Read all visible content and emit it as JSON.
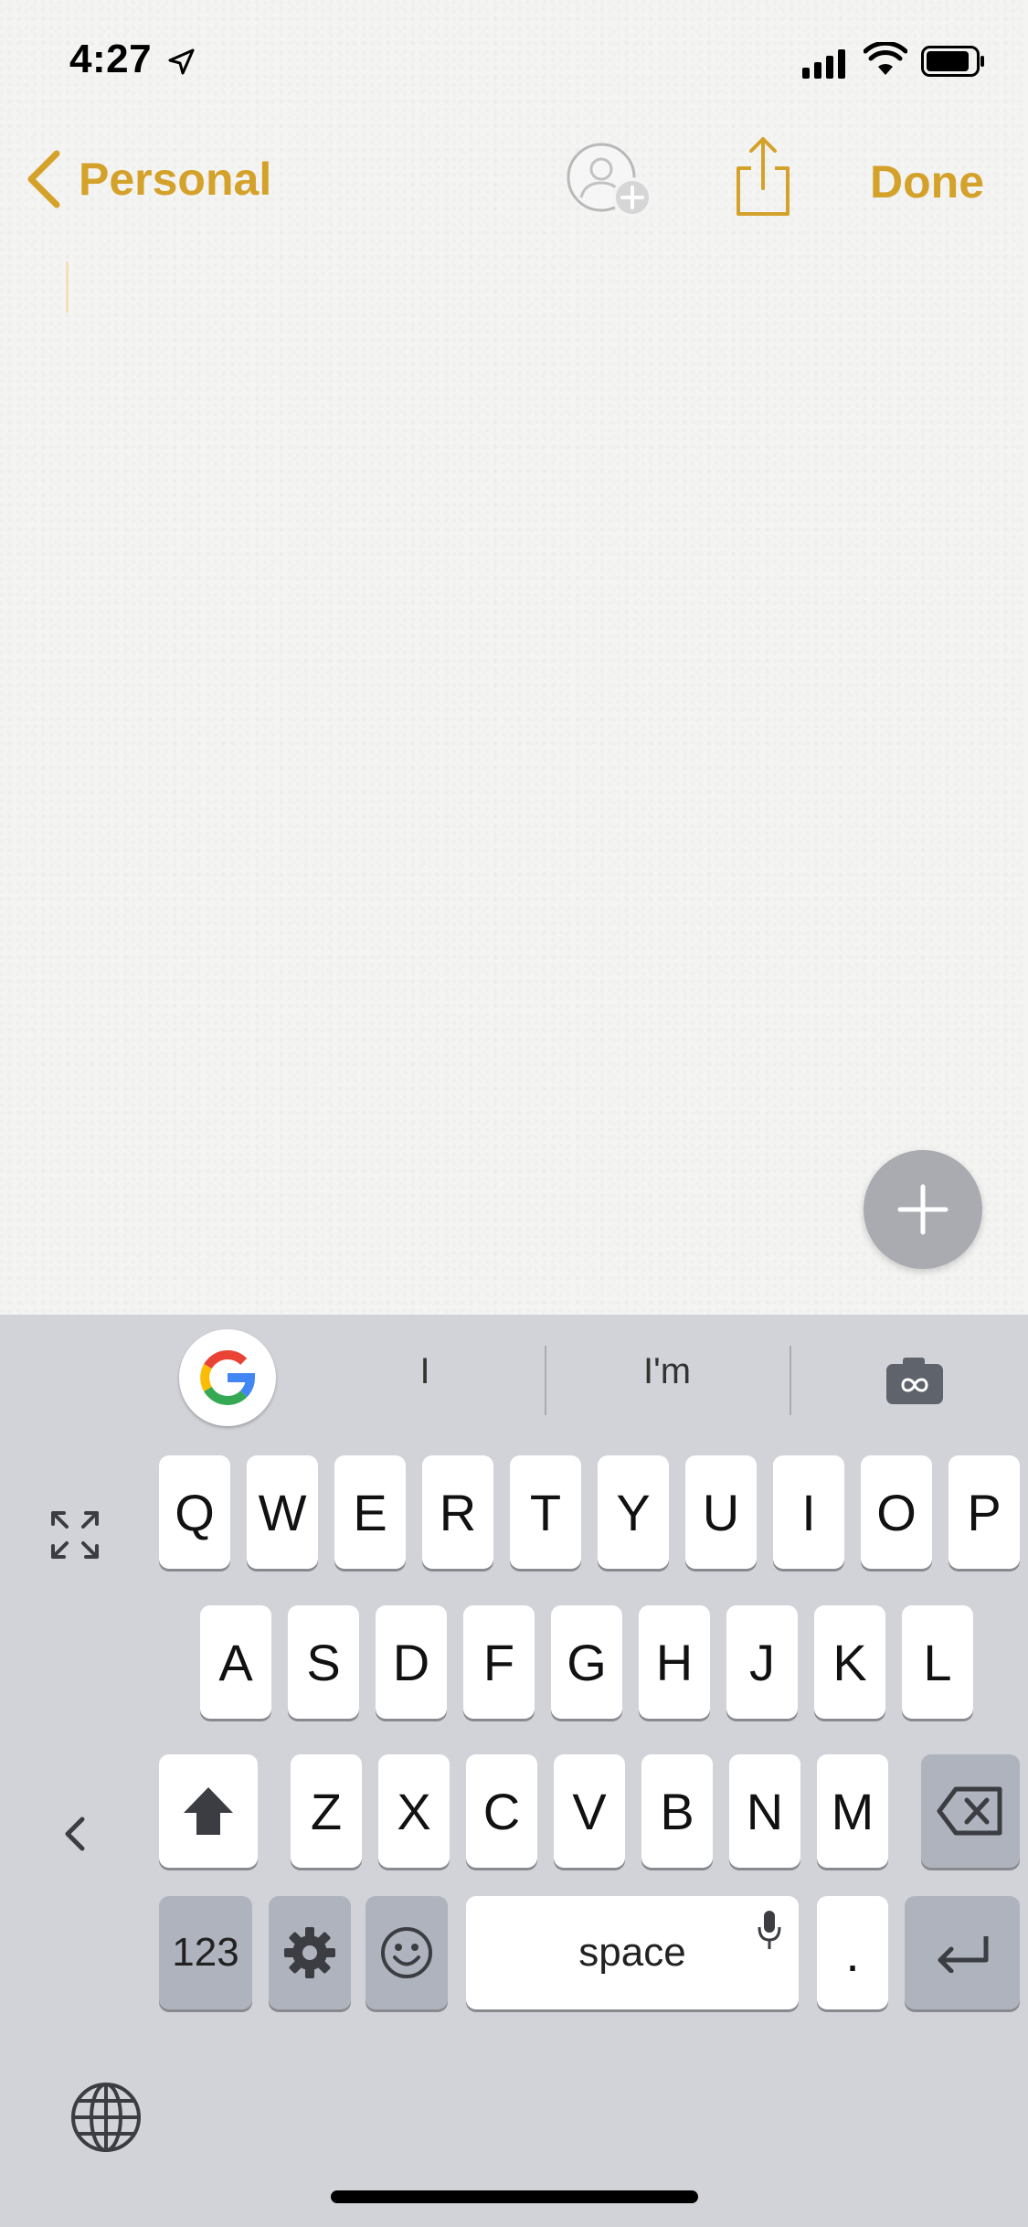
{
  "status_bar": {
    "time": "4:27"
  },
  "nav": {
    "back_label": "Personal",
    "done_label": "Done"
  },
  "colors": {
    "accent": "#d4a22a",
    "keyboard_bg": "#d1d3d9",
    "key_dark": "#aeb3bd"
  },
  "keyboard": {
    "suggestions": [
      "I",
      "I'm"
    ],
    "rows": [
      [
        "Q",
        "W",
        "E",
        "R",
        "T",
        "Y",
        "U",
        "I",
        "O",
        "P"
      ],
      [
        "A",
        "S",
        "D",
        "F",
        "G",
        "H",
        "J",
        "K",
        "L"
      ],
      [
        "Z",
        "X",
        "C",
        "V",
        "B",
        "N",
        "M"
      ]
    ],
    "numbers_label": "123",
    "space_label": "space",
    "period_label": "."
  },
  "icons": {
    "location": "location-arrow-icon",
    "signal": "cellular-signal-icon",
    "wifi": "wifi-icon",
    "battery": "battery-icon",
    "back": "chevron-left-icon",
    "add_person": "add-person-icon",
    "share": "share-icon",
    "fab": "plus-icon",
    "google": "google-logo-icon",
    "camera": "camera-icon",
    "expand": "expand-icon",
    "collapse": "chevron-left-icon",
    "shift": "shift-icon",
    "backspace": "backspace-icon",
    "settings": "gear-icon",
    "emoji": "emoji-icon",
    "mic": "microphone-icon",
    "return": "return-icon",
    "globe": "globe-icon"
  }
}
